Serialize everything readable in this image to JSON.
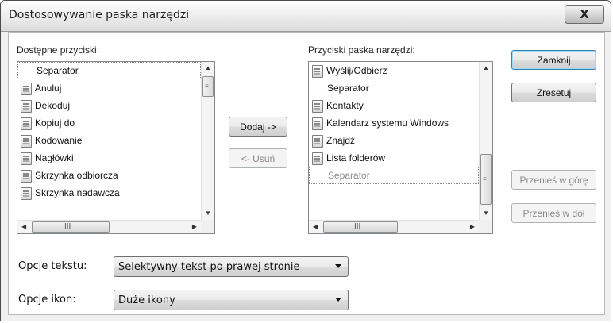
{
  "window": {
    "title": "Dostosowywanie paska narzędzi",
    "close_icon": "X"
  },
  "available": {
    "label": "Dostępne przyciski:",
    "items": [
      {
        "label": "Separator",
        "icon": "none"
      },
      {
        "label": "Anuluj",
        "icon": "cancel-icon"
      },
      {
        "label": "Dekoduj",
        "icon": "decode-icon"
      },
      {
        "label": "Kopiuj do",
        "icon": "copy-to-icon"
      },
      {
        "label": "Kodowanie",
        "icon": "encoding-icon"
      },
      {
        "label": "Nagłówki",
        "icon": "headers-icon"
      },
      {
        "label": "Skrzynka odbiorcza",
        "icon": "inbox-icon"
      },
      {
        "label": "Skrzynka nadawcza",
        "icon": "outbox-icon"
      }
    ],
    "scroll_grip": "III"
  },
  "toolbar_list": {
    "label": "Przyciski paska narzędzi:",
    "items": [
      {
        "label": "Wyślij/Odbierz",
        "icon": "send-receive-icon"
      },
      {
        "label": "Separator",
        "icon": "none"
      },
      {
        "label": "Kontakty",
        "icon": "contacts-icon"
      },
      {
        "label": "Kalendarz systemu Windows",
        "icon": "calendar-icon"
      },
      {
        "label": "Znajdź",
        "icon": "find-icon"
      },
      {
        "label": "Lista folderów",
        "icon": "folder-list-icon"
      },
      {
        "label": "Separator",
        "icon": "none"
      }
    ],
    "scroll_grip": "III"
  },
  "buttons": {
    "add": "Dodaj ->",
    "remove": "<- Usuń",
    "close": "Zamknij",
    "reset": "Zresetuj",
    "move_up": "Przenieś w górę",
    "move_down": "Przenieś w dół"
  },
  "options": {
    "text_label": "Opcje tekstu:",
    "text_value": "Selektywny tekst po prawej stronie",
    "icon_label": "Opcje ikon:",
    "icon_value": "Duże ikony"
  }
}
